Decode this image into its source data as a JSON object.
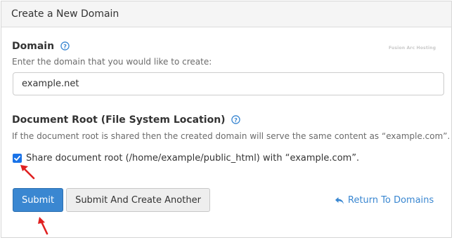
{
  "panel": {
    "title": "Create a New Domain",
    "watermark": "Fusion Arc Hosting"
  },
  "domain": {
    "label": "Domain",
    "help_icon": "question-circle-icon",
    "help_text": "Enter the domain that you would like to create:",
    "value": "example.net"
  },
  "document_root": {
    "label": "Document Root (File System Location)",
    "help_icon": "question-circle-icon",
    "help_text": "If the document root is shared then the created domain will serve the same content as “example.com”.",
    "share_checkbox": {
      "checked": true,
      "label": "Share document root (/home/example/public_html) with “example.com”."
    }
  },
  "actions": {
    "submit_label": "Submit",
    "submit_another_label": "Submit And Create Another",
    "return_label": "Return To Domains",
    "return_icon": "reply-arrow-icon"
  },
  "annotations": {
    "arrow_color": "#e02020",
    "arrow_icon": "red-pointer-arrow-icon"
  },
  "colors": {
    "primary": "#3a87d1",
    "link": "#3a87d1",
    "checkbox": "#1a73e8"
  }
}
